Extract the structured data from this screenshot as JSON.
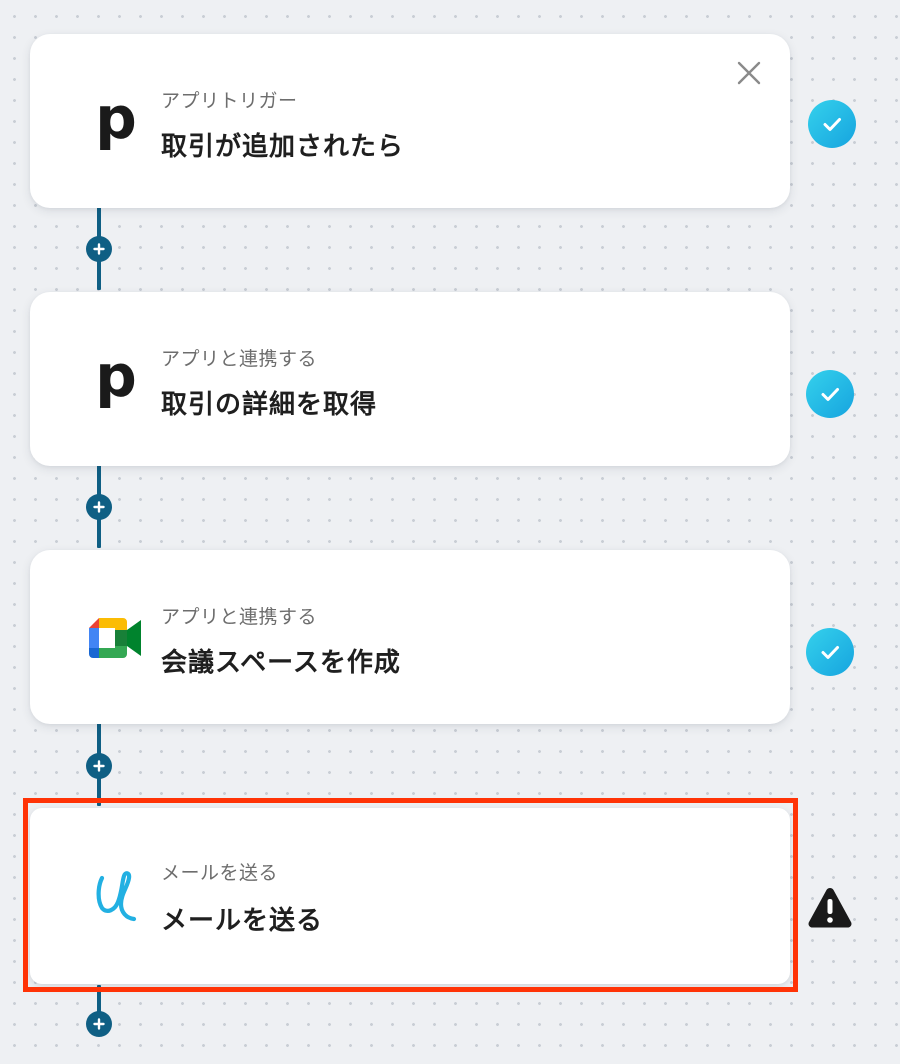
{
  "steps": [
    {
      "subtitle": "アプリトリガー",
      "title": "取引が追加されたら",
      "app_icon": "pipedrive-p-logo",
      "status": "complete",
      "has_close": true
    },
    {
      "subtitle": "アプリと連携する",
      "title": "取引の詳細を取得",
      "app_icon": "pipedrive-p-logo",
      "status": "complete"
    },
    {
      "subtitle": "アプリと連携する",
      "title": "会議スペースを作成",
      "app_icon": "google-meet-icon",
      "status": "complete"
    },
    {
      "subtitle": "メールを送る",
      "title": "メールを送る",
      "app_icon": "mail-cursive-icon",
      "status": "warning",
      "highlighted": true
    }
  ],
  "logos": {
    "pipedrive_letter": "p"
  },
  "icons": {
    "close": "close-icon",
    "add_step": "plus-icon",
    "complete": "check-circle-icon",
    "warning": "warning-triangle-icon"
  },
  "colors": {
    "background": "#eef0f3",
    "connector": "#0f5f84",
    "check_gradient_start": "#35d1ec",
    "check_gradient_end": "#16a4df",
    "highlight_border": "#ff3306",
    "warning": "#1a1a1a"
  }
}
